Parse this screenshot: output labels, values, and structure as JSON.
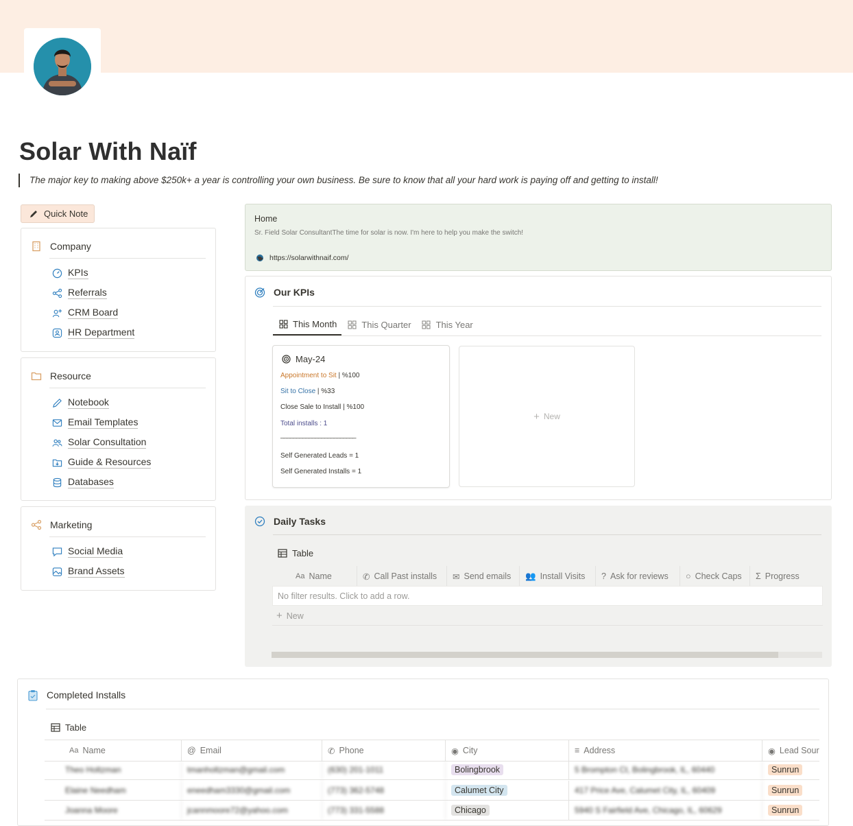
{
  "page": {
    "title": "Solar With Naïf",
    "quote": "The major key to making above $250k+ a year is controlling your own business. Be sure to know that all your hard work is paying off and getting to install!",
    "quick_note_label": "Quick Note"
  },
  "company": {
    "heading": "Company",
    "items": [
      {
        "label": "KPIs",
        "icon": "gauge-icon"
      },
      {
        "label": "Referrals",
        "icon": "share-icon"
      },
      {
        "label": "CRM Board",
        "icon": "user-plus-icon"
      },
      {
        "label": "HR Department",
        "icon": "id-badge-icon"
      }
    ]
  },
  "resource": {
    "heading": "Resource",
    "items": [
      {
        "label": "Notebook",
        "icon": "pen-icon"
      },
      {
        "label": "Email Templates",
        "icon": "mail-icon"
      },
      {
        "label": "Solar Consultation",
        "icon": "people-icon"
      },
      {
        "label": "Guide & Resources",
        "icon": "folder-download-icon"
      },
      {
        "label": "Databases",
        "icon": "database-icon"
      }
    ]
  },
  "marketing": {
    "heading": "Marketing",
    "items": [
      {
        "label": "Social Media",
        "icon": "chat-icon"
      },
      {
        "label": "Brand Assets",
        "icon": "image-icon"
      }
    ]
  },
  "home": {
    "title": "Home",
    "subtitle": "Sr. Field Solar ConsultantThe time for solar is now. I'm here to help you make the switch!",
    "link": "https://solarwithnaif.com/"
  },
  "kpis": {
    "heading": "Our KPIs",
    "tabs": [
      "This Month",
      "This Quarter",
      "This Year"
    ],
    "card": {
      "title": "May-24",
      "line1_label": "Appointment to Sit",
      "line1_value": " | %100",
      "line2_label": "Sit to Close",
      "line2_value": " | %33",
      "line3": "Close Sale to Install | %100",
      "line4": "Total installs : 1",
      "separator": "________________________",
      "line5": "Self Generated Leads = 1",
      "line6": "Self Generated Installs = 1"
    },
    "new_label": "New",
    "colors": {
      "orange": "#c9772a",
      "blue": "#3572a6",
      "purple": "#4c4c8c"
    }
  },
  "daily_tasks": {
    "heading": "Daily Tasks",
    "view_label": "Table",
    "columns": [
      "Name",
      "Call Past installs",
      "Send emails",
      "Install Visits",
      "Ask for reviews",
      "Check Caps",
      "Progress"
    ],
    "empty_text": "No filter results. Click to add a row.",
    "new_label": "New"
  },
  "completed_installs": {
    "heading": "Completed Installs",
    "view_label": "Table",
    "columns": [
      "Name",
      "Email",
      "Phone",
      "City",
      "Address",
      "Lead Sour"
    ],
    "rows": [
      {
        "name": "Theo Holtzman",
        "email": "tmanholtzman@gmail.com",
        "phone": "(630) 201-1011",
        "city": "Bolingbrook",
        "address": "5 Brompton Ct, Bolingbrook, IL, 60440",
        "lead": "Sunrun"
      },
      {
        "name": "Elaine Needham",
        "email": "eneedham3330@gmail.com",
        "phone": "(773) 362-5748",
        "city": "Calumet City",
        "address": "417 Price Ave, Calumet City, IL, 60409",
        "lead": "Sunrun"
      },
      {
        "name": "Joanna Moore",
        "email": "jcannmoore72@yahoo.com",
        "phone": "(773) 331-5588",
        "city": "Chicago",
        "address": "5940 S Fairfield Ave, Chicago, IL, 60629",
        "lead": "Sunrun"
      }
    ],
    "city_colors": {
      "Bolingbrook": "#e8deee",
      "Calumet City": "#d3e5ef",
      "Chicago": "#e3e2e0"
    },
    "lead_color": "#fadec9"
  }
}
